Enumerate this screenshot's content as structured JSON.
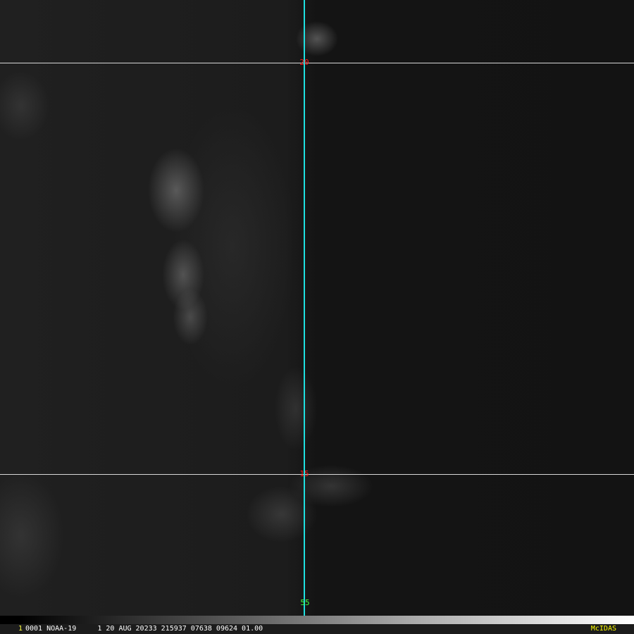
{
  "grid": {
    "lat_labels": [
      "20",
      "15"
    ],
    "lon_label": "55",
    "colors": {
      "lat_line": "#d8d8d8",
      "lon_line": "#1ee0e0",
      "lat_label": "#ff1a1a",
      "lon_label": "#40ff40"
    }
  },
  "infobar": {
    "frame": "1",
    "text": "0001 NOAA-19     1 20 AUG 20233 215937 07638 09624 01.00",
    "brand": "McIDAS"
  }
}
